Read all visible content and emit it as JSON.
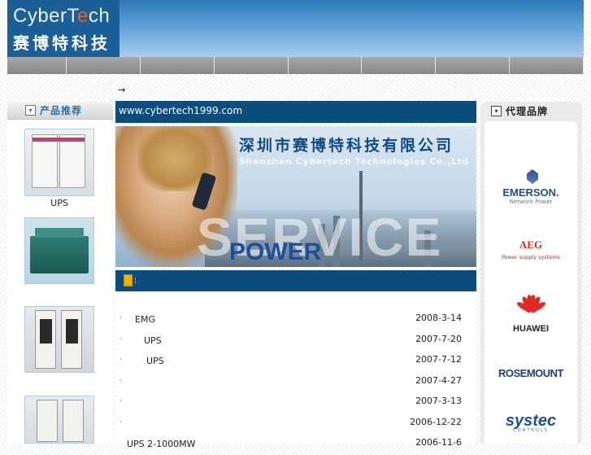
{
  "header": {
    "logo_en_prefix": "CyberT",
    "logo_en_accent": "e",
    "logo_en_suffix": "ch",
    "logo_cn": "赛博特科技",
    "nav_items": [
      "",
      "",
      "",
      "",
      "",
      "",
      "",
      ""
    ]
  },
  "breadcrumb_arrow": "→",
  "left": {
    "heading": "产品推荐",
    "products": [
      {
        "label": "UPS"
      },
      {
        "label": ""
      },
      {
        "label": ""
      },
      {
        "label": ""
      }
    ]
  },
  "center": {
    "url": "www.cybertech1999.com",
    "banner": {
      "title_cn": "深圳市赛博特科技有限公司",
      "title_en": "Shenzhen Cybertech Technologies Co.,Ltd",
      "watermark": "SERVICE",
      "power": "POWER"
    },
    "news": [
      {
        "bullet": "·",
        "title": "EMG",
        "date": "2008-3-14"
      },
      {
        "bullet": "·",
        "title": "UPS",
        "date": "2007-7-20"
      },
      {
        "bullet": "·",
        "title": "UPS",
        "date": "2007-7-12"
      },
      {
        "bullet": "·",
        "title": "",
        "date": "2007-4-27"
      },
      {
        "bullet": "·",
        "title": "",
        "date": "2007-3-13"
      },
      {
        "bullet": "·",
        "title": "",
        "date": "2006-12-22"
      },
      {
        "bullet": "",
        "title": "UPS 2-1000MW",
        "date": "2006-11-6"
      }
    ]
  },
  "right": {
    "heading": "代理品牌",
    "brands": {
      "emerson": "EMERSON.",
      "emerson_sub": "Network Power",
      "aeg": "AEG",
      "aeg_sub": "Power supply systems",
      "huawei": "HUAWEI",
      "rosemount": "ROSEMOUNT",
      "systec": "systec",
      "systec_sub": "CONTROLS"
    }
  },
  "colors": {
    "nav_blue": "#0b4d7c",
    "header_blue": "#2c78b8",
    "logo_accent": "#e0642a"
  }
}
